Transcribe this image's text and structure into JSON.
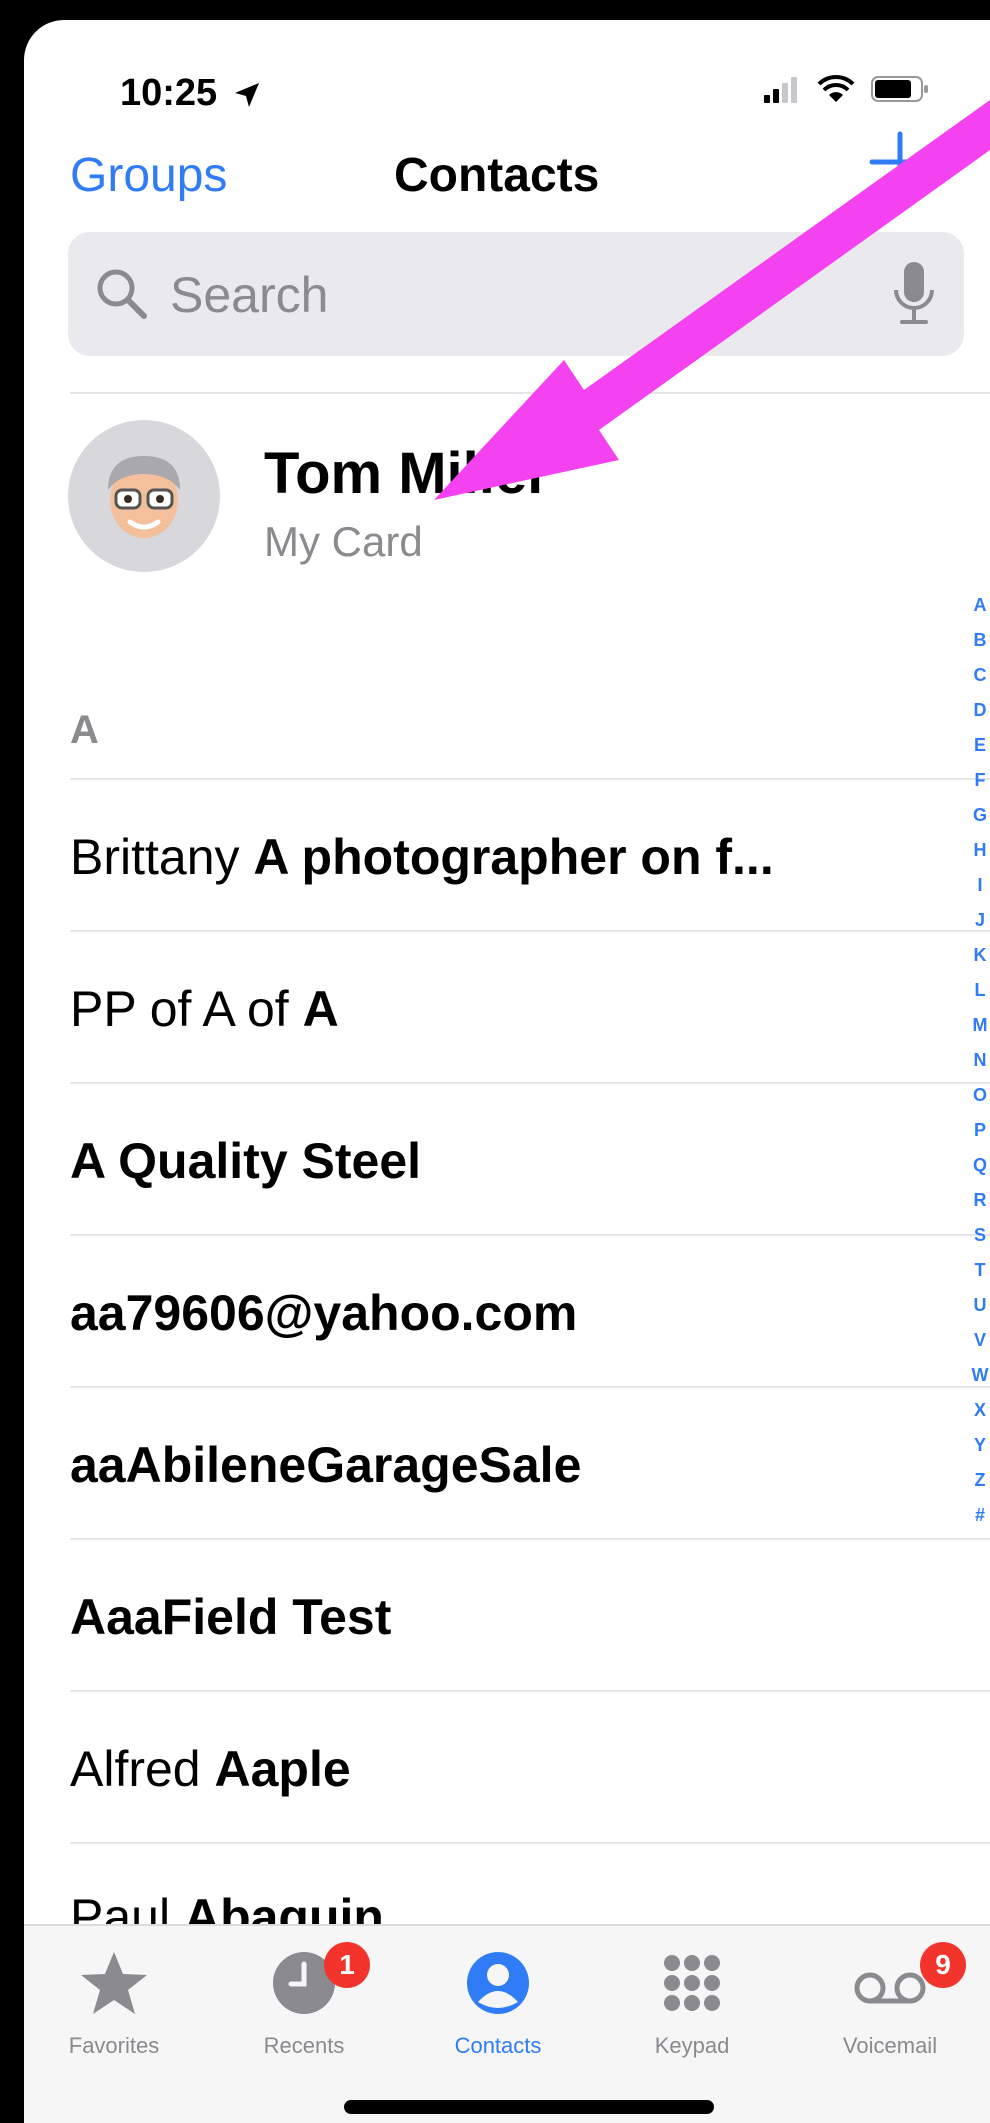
{
  "status": {
    "time": "10:25"
  },
  "nav": {
    "groups": "Groups",
    "title": "Contacts"
  },
  "search": {
    "placeholder": "Search"
  },
  "my_card": {
    "name": "Tom Miller",
    "subtitle": "My Card"
  },
  "section": "A",
  "contacts": [
    {
      "first": "Brittany ",
      "last": "A photographer on f..."
    },
    {
      "first": "PP of A of ",
      "last": "A"
    },
    {
      "first": "",
      "last": "A Quality Steel"
    },
    {
      "first": "",
      "last": "aa79606@yahoo.com"
    },
    {
      "first": "",
      "last": "aaAbileneGarageSale"
    },
    {
      "first": "",
      "last": "AaaField Test"
    },
    {
      "first": "Alfred ",
      "last": "Aaple"
    },
    {
      "first": "Paul ",
      "last": "Abaquin"
    }
  ],
  "index_letters": [
    "A",
    "B",
    "C",
    "D",
    "E",
    "F",
    "G",
    "H",
    "I",
    "J",
    "K",
    "L",
    "M",
    "N",
    "O",
    "P",
    "Q",
    "R",
    "S",
    "T",
    "U",
    "V",
    "W",
    "X",
    "Y",
    "Z",
    "#"
  ],
  "tabs": {
    "favorites": "Favorites",
    "recents": "Recents",
    "recents_badge": "1",
    "contacts": "Contacts",
    "keypad": "Keypad",
    "voicemail": "Voicemail",
    "voicemail_badge": "9"
  },
  "colors": {
    "accent": "#2f7cf6",
    "badge": "#f2342c",
    "annotation_arrow": "#f542f0"
  }
}
